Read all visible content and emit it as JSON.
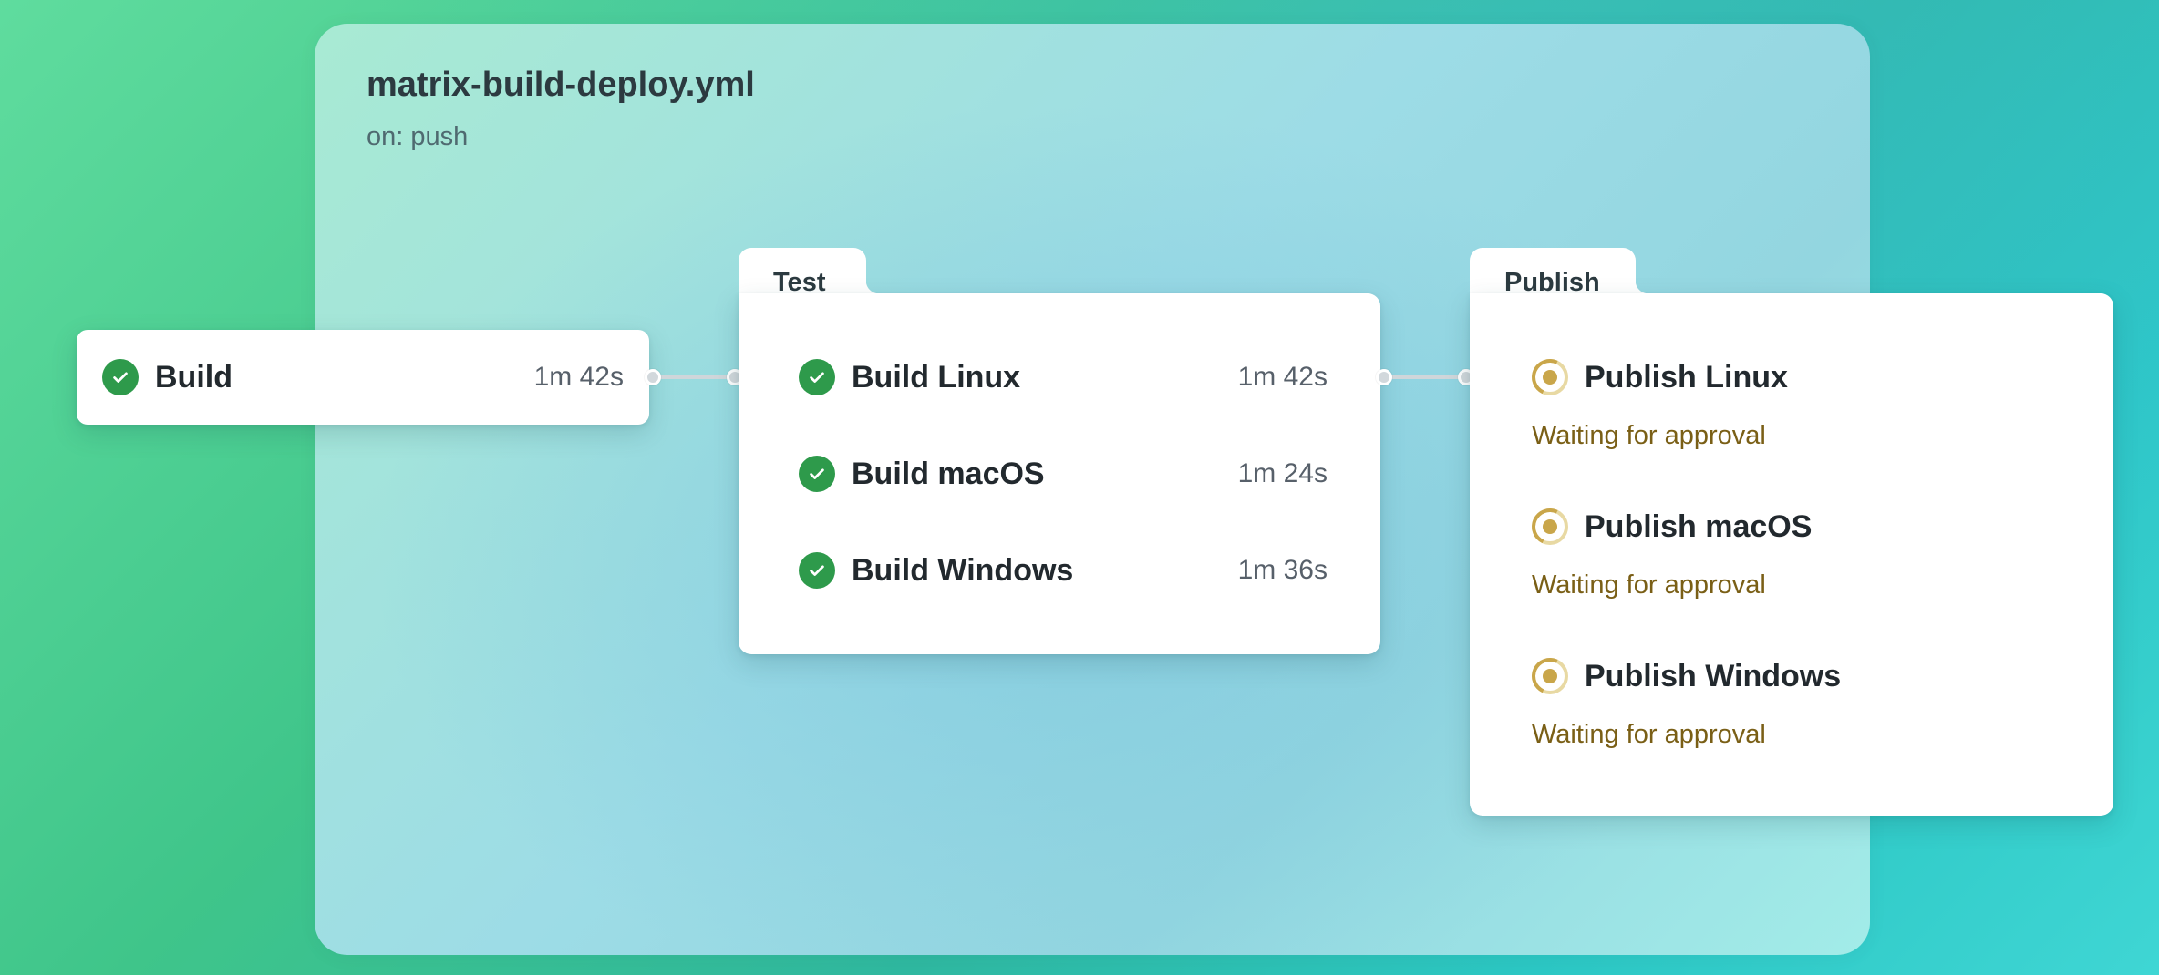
{
  "workflow": {
    "file_name": "matrix-build-deploy.yml",
    "trigger": "on: push"
  },
  "build": {
    "name": "Build",
    "duration": "1m 42s",
    "status": "success"
  },
  "test": {
    "group_label": "Test",
    "jobs": [
      {
        "name": "Build Linux",
        "duration": "1m 42s",
        "status": "success"
      },
      {
        "name": "Build macOS",
        "duration": "1m 24s",
        "status": "success"
      },
      {
        "name": "Build Windows",
        "duration": "1m 36s",
        "status": "success"
      }
    ]
  },
  "publish": {
    "group_label": "Publish",
    "jobs": [
      {
        "name": "Publish Linux",
        "status_text": "Waiting for approval",
        "status": "waiting"
      },
      {
        "name": "Publish macOS",
        "status_text": "Waiting for approval",
        "status": "waiting"
      },
      {
        "name": "Publish Windows",
        "status_text": "Waiting for approval",
        "status": "waiting"
      }
    ]
  },
  "colors": {
    "success": "#2e9a4b",
    "waiting": "#c9a64a",
    "waiting_text": "#7a5f16",
    "connector": "#cfd6da"
  }
}
